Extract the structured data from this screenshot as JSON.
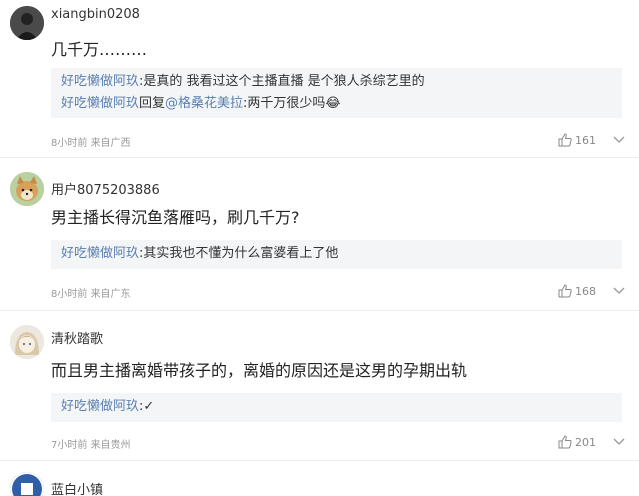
{
  "comments": [
    {
      "username": "xiangbin0208",
      "text": "几千万………",
      "replies": [
        {
          "name": "好吃懒做阿玖",
          "sep": ":",
          "text": "是真的 我看过这个主播直播 是个狼人杀综艺里的"
        },
        {
          "name": "好吃懒做阿玖",
          "sep": "回复",
          "mention": "@格桑花美拉",
          "text": ":两千万很少吗😂"
        }
      ],
      "time": "8小时前",
      "location": "来自广西",
      "likes": "161",
      "avatar_icon": "dark-figure-avatar"
    },
    {
      "username": "用户8075203886",
      "text": "男主播长得沉鱼落雁吗，刷几千万?",
      "replies": [
        {
          "name": "好吃懒做阿玖",
          "sep": ":",
          "text": "其实我也不懂为什么富婆看上了他"
        }
      ],
      "time": "8小时前",
      "location": "来自广东",
      "likes": "168",
      "avatar_icon": "shiba-dog-avatar"
    },
    {
      "username": "清秋踏歌",
      "text": "而且男主播离婚带孩子的，离婚的原因还是这男的孕期出轨",
      "replies": [
        {
          "name": "好吃懒做阿玖",
          "sep": ":",
          "text": "✓"
        }
      ],
      "time": "7小时前",
      "location": "来自贵州",
      "likes": "201",
      "avatar_icon": "anime-girl-avatar"
    },
    {
      "username": "蓝白小镇",
      "avatar_icon": "blue-badge-avatar"
    }
  ],
  "colors": {
    "reply_name": "#5a7fb0",
    "reply_bg": "#f3f5f7",
    "meta": "#9a9a9a"
  }
}
